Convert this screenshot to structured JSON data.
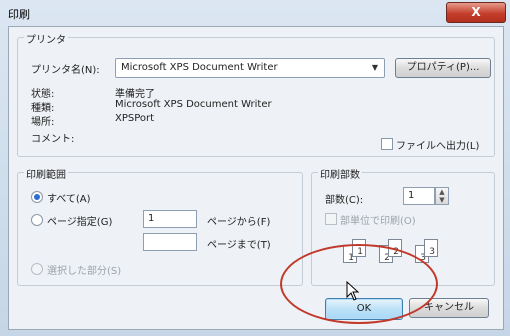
{
  "window": {
    "title": "印刷",
    "close_label": "X"
  },
  "printer": {
    "group_label": "プリンタ",
    "name_label": "プリンタ名(N):",
    "name_value": "Microsoft XPS Document Writer",
    "properties_label": "プロパティ(P)...",
    "status_label": "状態:",
    "status_value": "準備完了",
    "type_label": "種類:",
    "type_value": "Microsoft XPS Document Writer",
    "where_label": "場所:",
    "where_value": "XPSPort",
    "comment_label": "コメント:",
    "print_to_file_label": "ファイルへ出力(L)"
  },
  "range": {
    "group_label": "印刷範囲",
    "all_label": "すべて(A)",
    "pages_label": "ページ指定(G)",
    "from_value": "1",
    "from_label": "ページから(F)",
    "to_value": "",
    "to_label": "ページまで(T)",
    "selection_label": "選択した部分(S)"
  },
  "copies": {
    "group_label": "印刷部数",
    "count_label": "部数(C):",
    "count_value": "1",
    "collate_label": "部単位で印刷(O)",
    "collate_pages": [
      "1",
      "1",
      "2",
      "2",
      "3",
      "3"
    ]
  },
  "buttons": {
    "ok_label": "OK",
    "cancel_label": "キャンセル"
  },
  "colors": {
    "highlight": "#c0392b",
    "ok_accent": "#a7d8f6"
  }
}
